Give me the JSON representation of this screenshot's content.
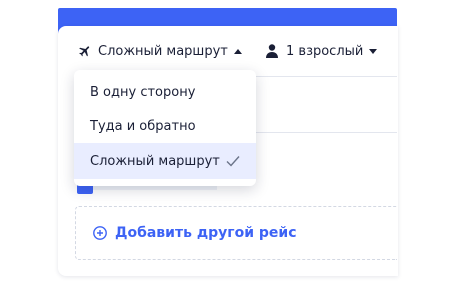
{
  "header": {
    "route_type_selected": "Сложный маршрут",
    "passengers_label": "1 взрослый"
  },
  "route_menu": {
    "options": [
      {
        "label": "В одну сторону"
      },
      {
        "label": "Туда и обратно"
      },
      {
        "label": "Сложный маршрут",
        "selected": true
      }
    ]
  },
  "actions": {
    "add_flight_label": "Добавить другой рейс"
  },
  "colors": {
    "accent": "#3d63f5",
    "selected_bg": "#e9edff",
    "text": "#1a1f36"
  }
}
